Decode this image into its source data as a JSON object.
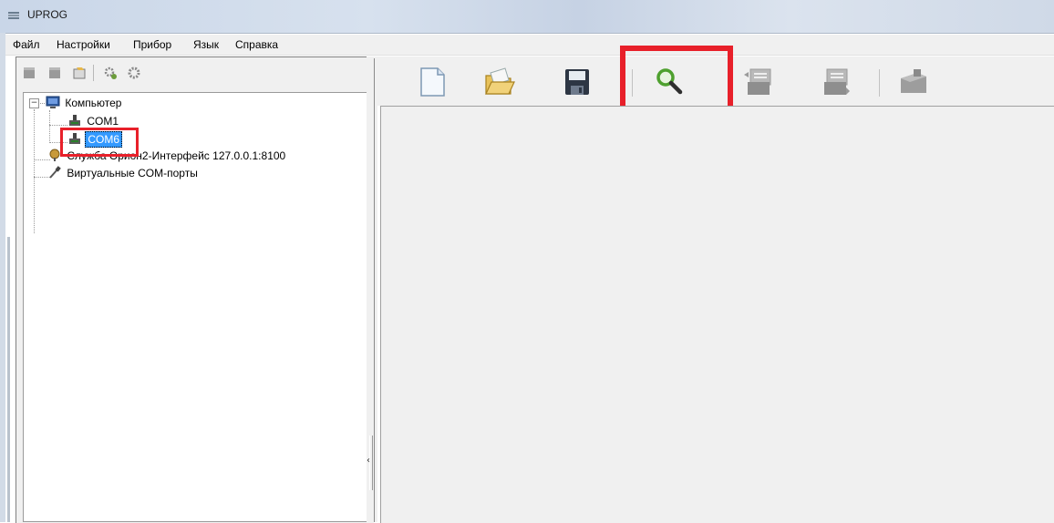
{
  "window": {
    "title": "UPROG"
  },
  "menu": [
    "Файл",
    "Настройки",
    "Прибор",
    "Язык",
    "Справка"
  ],
  "tree": {
    "root": "Компьютер",
    "ports": [
      "COM1",
      "COM6"
    ],
    "selected": "COM6",
    "service": "Служба Орион2-Интерфейс 127.0.0.1:8100",
    "virtual": "Виртуальные COM-порты"
  },
  "icons": {
    "left_toolbar": [
      "device-icon",
      "device-icon",
      "properties-icon",
      "gear-add-icon",
      "gear-icon"
    ],
    "right_toolbar": [
      "new-file-icon",
      "open-folder-icon",
      "save-icon",
      "search-icon",
      "read-config-icon",
      "write-config-icon",
      "firmware-icon"
    ]
  },
  "colors": {
    "highlight": "#e8202a",
    "selection": "#3399ff"
  }
}
